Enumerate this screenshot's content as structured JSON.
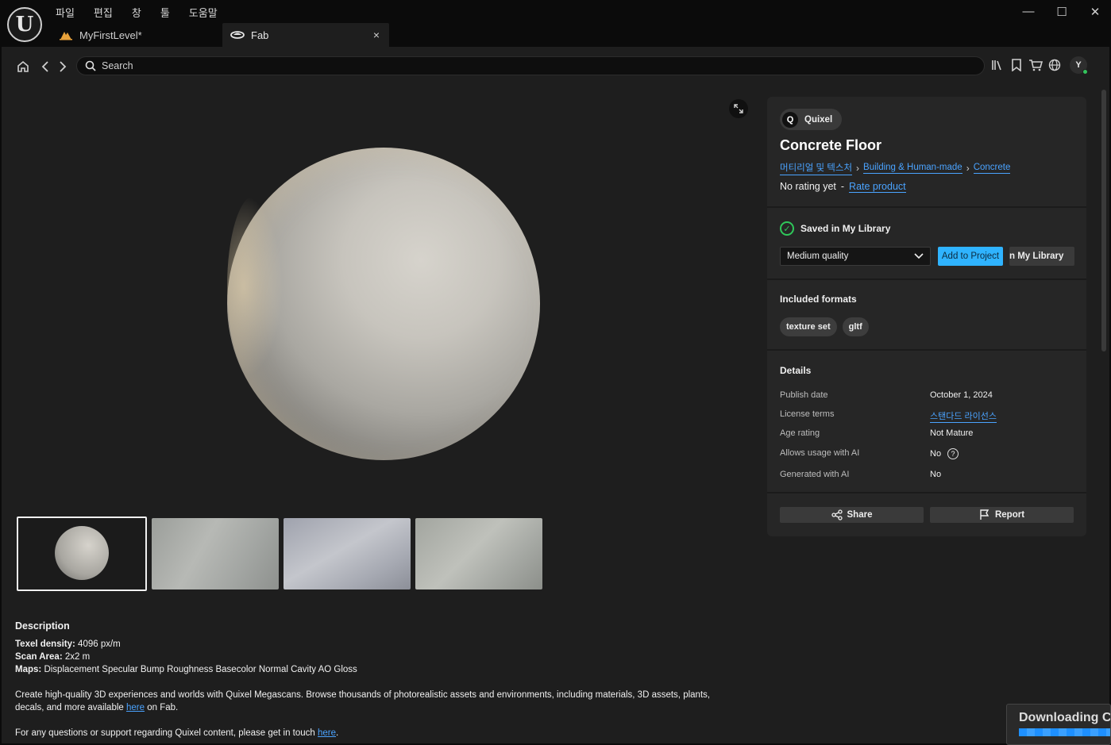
{
  "menu": [
    "파일",
    "편집",
    "창",
    "툴",
    "도움말"
  ],
  "tabs": [
    {
      "label": "MyFirstLevel*",
      "icon": "level-icon"
    },
    {
      "label": "Fab",
      "icon": "fab-icon",
      "close": "×"
    }
  ],
  "window_controls": {
    "minimize": "—",
    "maximize": "☐",
    "close": "✕"
  },
  "nav": {
    "search_placeholder": "Search",
    "avatar": "Y"
  },
  "product": {
    "publisher": "Quixel",
    "title": "Concrete Floor",
    "breadcrumb": [
      "머티리얼 및 텍스처",
      "Building & Human-made",
      "Concrete"
    ],
    "rating_text": "No rating yet",
    "rating_sep": "-",
    "rate_link": "Rate product"
  },
  "library": {
    "status": "Saved in My Library",
    "quality": "Medium quality",
    "add_button": "Add to Project",
    "view_button": "View in My Library"
  },
  "formats": {
    "heading": "Included formats",
    "items": [
      "texture set",
      "gltf"
    ]
  },
  "details": {
    "heading": "Details",
    "rows": [
      {
        "key": "Publish date",
        "value": "October 1, 2024"
      },
      {
        "key": "License terms",
        "value": "스탠다드 라이선스"
      },
      {
        "key": "Age rating",
        "value": "Not Mature"
      },
      {
        "key": "Allows usage with AI",
        "value": "No"
      },
      {
        "key": "Generated with AI",
        "value": "No"
      }
    ]
  },
  "actions": {
    "share": "Share",
    "report": "Report"
  },
  "description": {
    "heading": "Description",
    "texel_label": "Texel density:",
    "texel_value": "4096 px/m",
    "scan_label": "Scan Area:",
    "scan_value": "2x2 m",
    "maps_label": "Maps:",
    "maps_value": "Displacement Specular Bump Roughness Basecolor Normal Cavity AO Gloss",
    "para1_a": "Create high-quality 3D experiences and worlds with Quixel Megascans. Browse thousands of photorealistic assets and environments, including materials, 3D assets, plants, decals, and more available ",
    "para1_link": "here",
    "para1_b": " on Fab.",
    "para2_a": "For any questions or support regarding Quixel content, please get in touch ",
    "para2_link": "here",
    "para2_b": "."
  },
  "download": {
    "text": "Downloading Co",
    "progress": 1.0
  },
  "colors": {
    "accent": "#2fb3ff",
    "link": "#4aa3ff",
    "success": "#2fc75a"
  }
}
